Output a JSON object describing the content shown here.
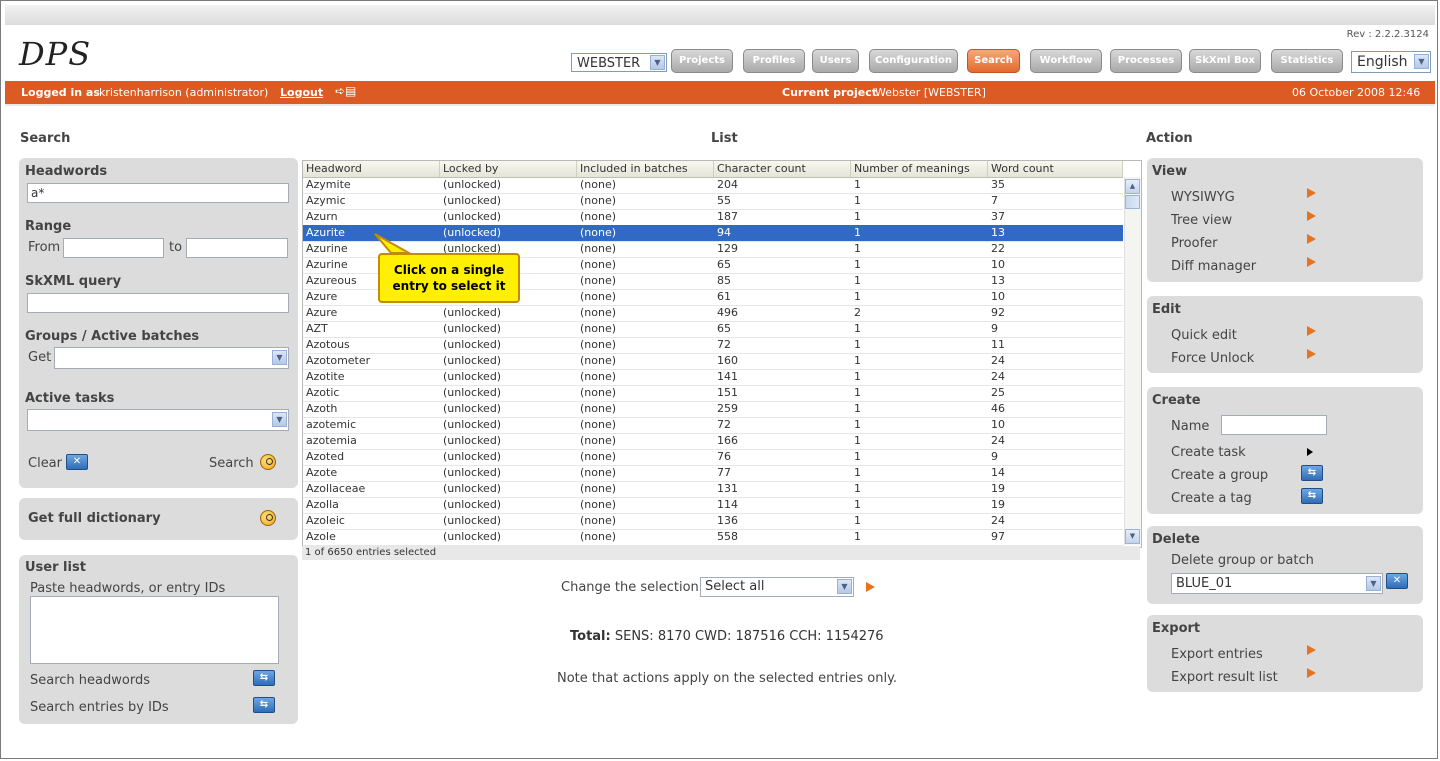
{
  "app": {
    "logo": "DPS",
    "rev": "Rev : 2.2.2.3124"
  },
  "header": {
    "project_select": "WEBSTER",
    "nav": [
      "Projects",
      "Profiles",
      "Users",
      "Configuration",
      "Search",
      "Workflow",
      "Processes",
      "SkXml Box",
      "Statistics"
    ],
    "active_nav": "Search",
    "language": "English"
  },
  "statusbar": {
    "logged_label": "Logged in as",
    "user": "kristenharrison (administrator)",
    "logout": "Logout",
    "project_label": "Current project",
    "project": "Webster [WEBSTER]",
    "datetime": "06 October 2008 12:46"
  },
  "search": {
    "title": "Search",
    "headwords_label": "Headwords",
    "headwords_value": "a*",
    "range_label": "Range",
    "from_label": "From",
    "to_label": "to",
    "skxml_label": "SkXML query",
    "groups_label": "Groups / Active batches",
    "get_label": "Get",
    "tasks_label": "Active tasks",
    "clear_label": "Clear",
    "search_label": "Search",
    "full_dict_label": "Get full dictionary",
    "userlist_label": "User list",
    "paste_label": "Paste headwords, or entry IDs",
    "search_headwords": "Search headwords",
    "search_ids": "Search entries by IDs"
  },
  "list": {
    "title": "List",
    "columns": [
      "Headword",
      "Locked by",
      "Included in batches",
      "Character count",
      "Number of meanings",
      "Word count"
    ],
    "rows": [
      [
        "Azymite",
        "(unlocked)",
        "(none)",
        "204",
        "1",
        "35"
      ],
      [
        "Azymic",
        "(unlocked)",
        "(none)",
        "55",
        "1",
        "7"
      ],
      [
        "Azurn",
        "(unlocked)",
        "(none)",
        "187",
        "1",
        "37"
      ],
      [
        "Azurite",
        "(unlocked)",
        "(none)",
        "94",
        "1",
        "13"
      ],
      [
        "Azurine",
        "(unlocked)",
        "(none)",
        "129",
        "1",
        "22"
      ],
      [
        "Azurine",
        "",
        "(none)",
        "65",
        "1",
        "10"
      ],
      [
        "Azureous",
        "",
        "(none)",
        "85",
        "1",
        "13"
      ],
      [
        "Azure",
        "",
        "(none)",
        "61",
        "1",
        "10"
      ],
      [
        "Azure",
        "(unlocked)",
        "(none)",
        "496",
        "2",
        "92"
      ],
      [
        "AZT",
        "(unlocked)",
        "(none)",
        "65",
        "1",
        "9"
      ],
      [
        "Azotous",
        "(unlocked)",
        "(none)",
        "72",
        "1",
        "11"
      ],
      [
        "Azotometer",
        "(unlocked)",
        "(none)",
        "160",
        "1",
        "24"
      ],
      [
        "Azotite",
        "(unlocked)",
        "(none)",
        "141",
        "1",
        "24"
      ],
      [
        "Azotic",
        "(unlocked)",
        "(none)",
        "151",
        "1",
        "25"
      ],
      [
        "Azoth",
        "(unlocked)",
        "(none)",
        "259",
        "1",
        "46"
      ],
      [
        "azotemic",
        "(unlocked)",
        "(none)",
        "72",
        "1",
        "10"
      ],
      [
        "azotemia",
        "(unlocked)",
        "(none)",
        "166",
        "1",
        "24"
      ],
      [
        "Azoted",
        "(unlocked)",
        "(none)",
        "76",
        "1",
        "9"
      ],
      [
        "Azote",
        "(unlocked)",
        "(none)",
        "77",
        "1",
        "14"
      ],
      [
        "Azollaceae",
        "(unlocked)",
        "(none)",
        "131",
        "1",
        "19"
      ],
      [
        "Azolla",
        "(unlocked)",
        "(none)",
        "114",
        "1",
        "19"
      ],
      [
        "Azoleic",
        "(unlocked)",
        "(none)",
        "136",
        "1",
        "24"
      ],
      [
        "Azole",
        "(unlocked)",
        "(none)",
        "558",
        "1",
        "97"
      ]
    ],
    "selected_row": 3,
    "status": "1 of 6650 entries selected",
    "callout": "Click on a single entry to select it",
    "change_label": "Change the selection",
    "change_value": "Select all",
    "total_label": "Total:",
    "total_value": "SENS: 8170 CWD: 187516 CCH: 1154276",
    "note": "Note that actions apply on the selected entries only."
  },
  "action": {
    "title": "Action",
    "view_label": "View",
    "view_items": [
      "WYSIWYG",
      "Tree view",
      "Proofer",
      "Diff manager"
    ],
    "edit_label": "Edit",
    "edit_items": [
      "Quick edit",
      "Force Unlock"
    ],
    "create_label": "Create",
    "name_label": "Name",
    "create_task": "Create task",
    "create_group": "Create a group",
    "create_tag": "Create a tag",
    "delete_label": "Delete",
    "delete_group_label": "Delete group or batch",
    "delete_value": "BLUE_01",
    "export_label": "Export",
    "export_entries": "Export entries",
    "export_result": "Export result list"
  }
}
